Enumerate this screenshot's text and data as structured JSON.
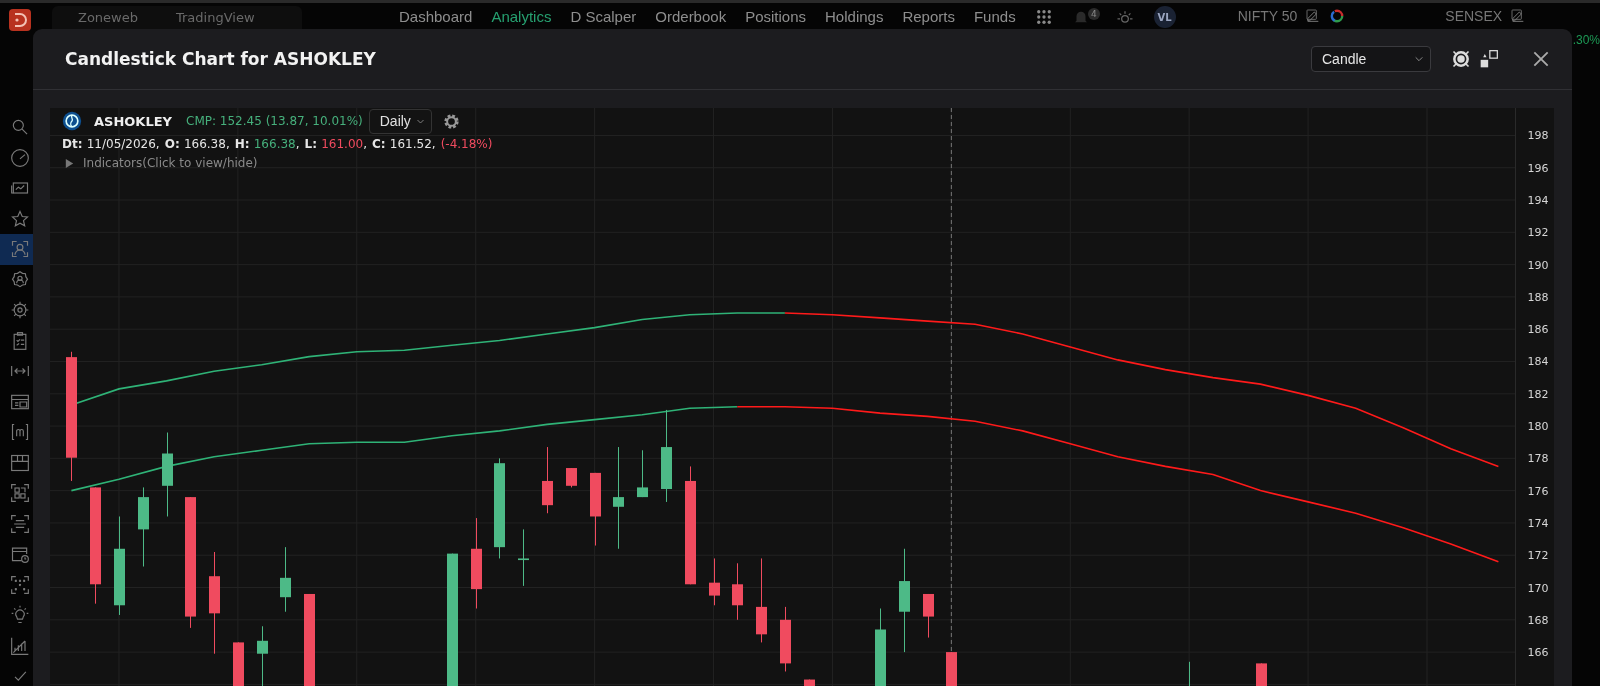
{
  "nav": {
    "logo": {
      "kind": "app"
    },
    "tabs": [
      {
        "label": "Zoneweb",
        "selected": false
      },
      {
        "label": "TradingView",
        "selected": false
      }
    ],
    "items": [
      {
        "label": "Dashboard",
        "selected": false
      },
      {
        "label": "Analytics",
        "selected": true
      },
      {
        "label": "D Scalper",
        "selected": false
      },
      {
        "label": "Orderbook",
        "selected": false
      },
      {
        "label": "Positions",
        "selected": false
      },
      {
        "label": "Holdings",
        "selected": false
      },
      {
        "label": "Reports",
        "selected": false
      },
      {
        "label": "Funds",
        "selected": false
      }
    ],
    "notification_count": "4",
    "avatar": "VL",
    "indices": [
      {
        "name": "NIFTY 50"
      },
      {
        "name": "SENSEX",
        "change": ".30%"
      }
    ]
  },
  "sidebar": {
    "items": [
      {
        "selected": false
      },
      {
        "selected": false
      },
      {
        "selected": false
      },
      {
        "selected": false
      },
      {
        "selected": true
      },
      {
        "selected": false
      },
      {
        "selected": false
      },
      {
        "selected": false
      },
      {
        "selected": false
      },
      {
        "selected": false
      },
      {
        "selected": false
      },
      {
        "selected": false
      },
      {
        "selected": false
      },
      {
        "selected": false
      },
      {
        "selected": false
      },
      {
        "selected": false
      },
      {
        "selected": false
      },
      {
        "selected": false
      },
      {
        "selected": false
      }
    ]
  },
  "modal": {
    "title": "Candlestick Chart for ASHOKLEY",
    "chart_type": "Candle",
    "chart": {
      "symbol": "ASHOKLEY",
      "cmp": "CMP: 152.45 (13.87, 10.01%)",
      "interval": "Daily",
      "ohlc": [
        {
          "label": "Dt:",
          "value": "11/05/2026",
          "sep": ","
        },
        {
          "label": "O:",
          "value": "166.38",
          "sep": ","
        },
        {
          "label": "H:",
          "value": "166.38",
          "color": "#46b07c",
          "sep": ","
        },
        {
          "label": "L:",
          "value": "161.00",
          "color": "#f04b5f",
          "sep": ","
        },
        {
          "label": "C:",
          "value": "161.52",
          "sep": ","
        },
        {
          "value": "(-4.18%)",
          "color": "#f04b5f"
        }
      ],
      "indicators": {
        "label": "Indicators(Click to view/hide)",
        "expanded": false
      },
      "price_axis": {
        "labels": [
          "198",
          "196",
          "194",
          "192",
          "190",
          "188",
          "186",
          "184",
          "182",
          "180",
          "178",
          "176",
          "174",
          "172",
          "170",
          "168",
          "166"
        ]
      }
    }
  }
}
